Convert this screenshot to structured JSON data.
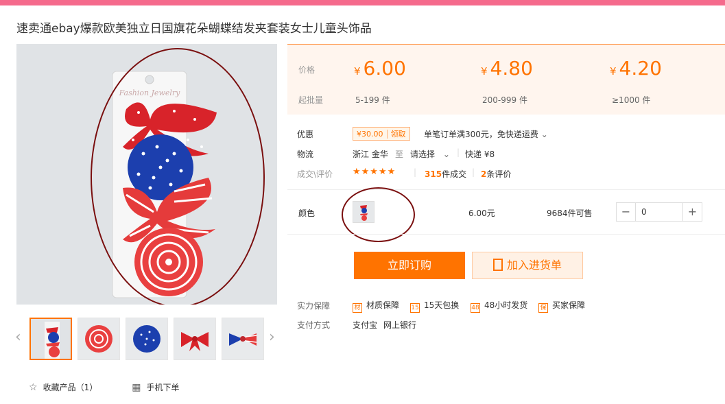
{
  "product": {
    "title": "速卖通ebay爆款欧美独立日国旗花朵蝴蝶结发夹套装女士儿童头饰品"
  },
  "gallery": {
    "card_text": "Fashion Jewelry",
    "prev_icon": "chevron-left-icon",
    "next_icon": "chevron-right-icon"
  },
  "actions": {
    "favorite_label": "收藏产品（1）",
    "mobile_order_label": "手机下单"
  },
  "pricing": {
    "price_label": "价格",
    "moq_label": "起批量",
    "currency": "¥",
    "tiers": [
      {
        "price": "6.00",
        "range": "5-199 件"
      },
      {
        "price": "4.80",
        "range": "200-999 件"
      },
      {
        "price": "4.20",
        "range": "≥1000 件"
      }
    ]
  },
  "promo": {
    "label": "优惠",
    "coupon_amount": "¥30.00",
    "coupon_action": "领取",
    "shipping_text": "单笔订单满300元，免快递运费"
  },
  "logistics": {
    "label": "物流",
    "from": "浙江 金华",
    "to_word": "至",
    "select_text": "请选择",
    "delivery": "快递 ¥8"
  },
  "reviews": {
    "label": "成交\\评价",
    "stars": "★★★★★",
    "sold_count": "315",
    "sold_suffix": "件成交",
    "review_count": "2",
    "review_suffix": "条评价"
  },
  "variant": {
    "label": "颜色",
    "unit_price": "6.00元",
    "stock": "9684件可售",
    "quantity": "0"
  },
  "buttons": {
    "buy_now": "立即订购",
    "add_cart": "加入进货单"
  },
  "guarantee": {
    "label": "实力保障",
    "items": [
      "材质保障",
      "15天包换",
      "48小时发货",
      "买家保障"
    ],
    "icons": [
      "材",
      "15",
      "48",
      "保"
    ]
  },
  "payment": {
    "label": "支付方式",
    "methods": [
      "支付宝",
      "网上银行"
    ]
  },
  "colors": {
    "accent": "#ff7300",
    "topbar": "#f56a8c",
    "annotation": "#7a0f0f"
  }
}
